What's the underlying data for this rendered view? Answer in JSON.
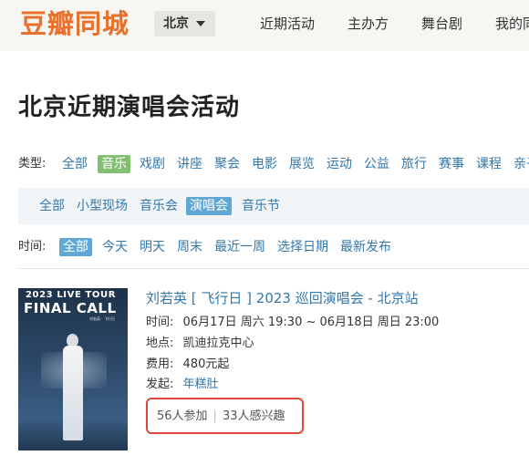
{
  "header": {
    "logo": "豆瓣同城",
    "city": "北京",
    "nav": [
      "近期活动",
      "主办方",
      "舞台剧",
      "我的同城"
    ]
  },
  "page_title": "北京近期演唱会活动",
  "type_filter": {
    "label": "类型:",
    "items": [
      "全部",
      "音乐",
      "戏剧",
      "讲座",
      "聚会",
      "电影",
      "展览",
      "运动",
      "公益",
      "旅行",
      "赛事",
      "课程",
      "亲子"
    ],
    "active": "音乐"
  },
  "subtype_filter": {
    "items": [
      "全部",
      "小型现场",
      "音乐会",
      "演唱会",
      "音乐节"
    ],
    "active": "演唱会"
  },
  "time_filter": {
    "label": "时间:",
    "items": [
      "全部",
      "今天",
      "明天",
      "周末",
      "最近一周",
      "选择日期",
      "最新发布"
    ],
    "active": "全部"
  },
  "event": {
    "poster_line1": "2023 LIVE TOUR",
    "poster_line2": "FINAL CALL",
    "poster_small": "刘若英 · 飞行日",
    "title": "刘若英 [ 飞行日 ] 2023 巡回演唱会 - 北京站",
    "time_label": "时间:",
    "time_value": "06月17日 周六 19:30 ~ 06月18日 周日 23:00",
    "place_label": "地点:",
    "place_value": "凯迪拉克中心",
    "fee_label": "费用:",
    "fee_value": "480元起",
    "host_label": "发起:",
    "host_value": "年糕肚",
    "joined": "56人参加",
    "interested": "33人感兴趣"
  }
}
